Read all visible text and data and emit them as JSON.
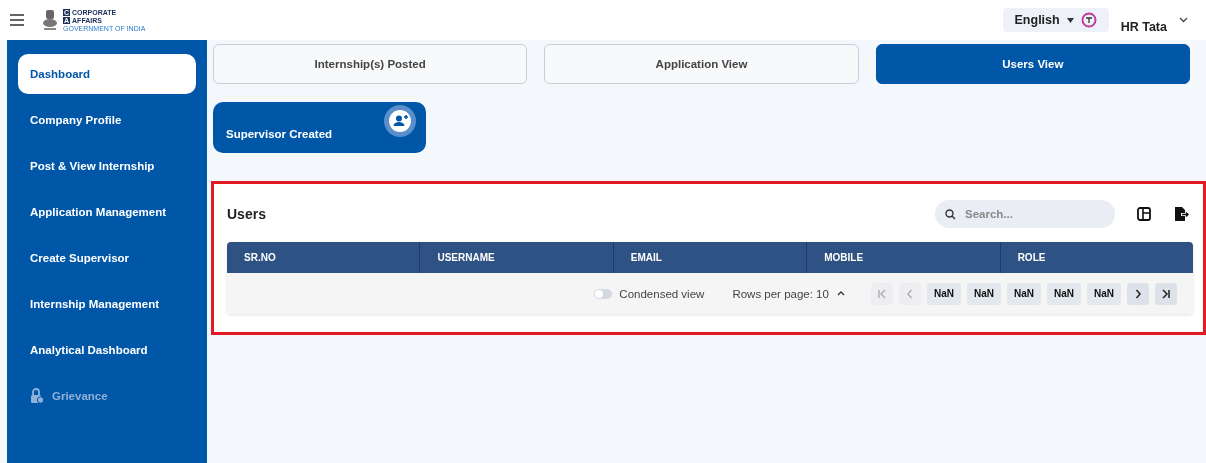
{
  "header": {
    "logo": {
      "line1_letter": "C",
      "line1": "CORPORATE",
      "line2_letter": "A",
      "line2": "AFFAIRS",
      "subtitle": "GOVERNMENT OF INDIA"
    },
    "language": "English",
    "user": "HR Tata"
  },
  "sidebar": {
    "items": [
      {
        "label": "Dashboard",
        "selected": true,
        "disabled": false
      },
      {
        "label": "Company Profile",
        "selected": false,
        "disabled": false
      },
      {
        "label": "Post & View Internship",
        "selected": false,
        "disabled": false
      },
      {
        "label": "Application Management",
        "selected": false,
        "disabled": false
      },
      {
        "label": "Create Supervisor",
        "selected": false,
        "disabled": false
      },
      {
        "label": "Internship Management",
        "selected": false,
        "disabled": false
      },
      {
        "label": "Analytical Dashboard",
        "selected": false,
        "disabled": false
      },
      {
        "label": "Grievance",
        "selected": false,
        "disabled": true
      }
    ]
  },
  "tabs": [
    {
      "label": "Internship(s) Posted",
      "selected": false
    },
    {
      "label": "Application View",
      "selected": false
    },
    {
      "label": "Users View",
      "selected": true
    }
  ],
  "summary_card": {
    "label": "Supervisor Created"
  },
  "users_panel": {
    "title": "Users",
    "search": {
      "placeholder": "Search..."
    },
    "table": {
      "columns": [
        "SR.NO",
        "USERNAME",
        "EMAIL",
        "MOBILE",
        "ROLE"
      ]
    },
    "footer": {
      "condensed_view": {
        "label": "Condensed view",
        "on": false
      },
      "rows_per_page": "Rows per page: 10",
      "pagination": [
        {
          "kind": "first",
          "disabled": true
        },
        {
          "kind": "prev",
          "disabled": true
        },
        {
          "kind": "page",
          "label": "NaN",
          "disabled": false
        },
        {
          "kind": "page",
          "label": "NaN",
          "disabled": false
        },
        {
          "kind": "page",
          "label": "NaN",
          "disabled": false
        },
        {
          "kind": "page",
          "label": "NaN",
          "disabled": false
        },
        {
          "kind": "page",
          "label": "NaN",
          "disabled": false
        },
        {
          "kind": "next",
          "disabled": false
        },
        {
          "kind": "last",
          "disabled": false
        }
      ]
    }
  }
}
